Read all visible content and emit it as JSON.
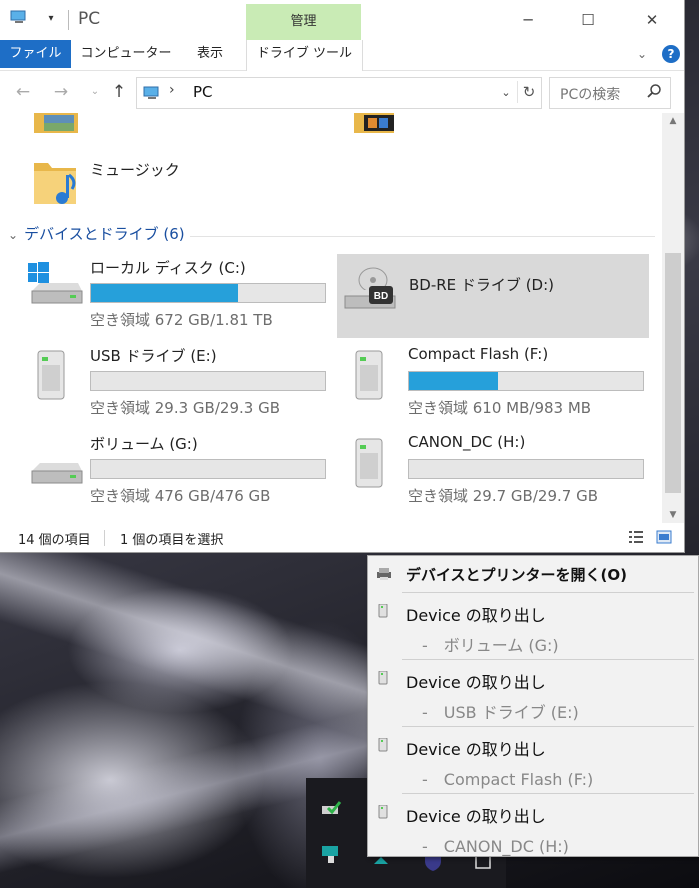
{
  "window": {
    "title": "PC",
    "qa_dropdown_glyph": "▾",
    "manage_tab": "管理",
    "controls": {
      "minimize": "─",
      "maximize": "☐",
      "close": "✕"
    }
  },
  "ribbon": {
    "tabs": [
      "ファイル",
      "コンピューター",
      "表示",
      "ドライブ ツール"
    ],
    "collapse_glyph": "⌄",
    "help_glyph": "?"
  },
  "nav": {
    "back": "←",
    "forward": "→",
    "recent": "⌄",
    "up": "↑",
    "breadcrumb_sep": "›",
    "location": "PC",
    "dropdown": "⌄",
    "refresh": "↻"
  },
  "search": {
    "placeholder": "PCの検索"
  },
  "content": {
    "music_label": "ミュージック",
    "group_header": "デバイスとドライブ (6)",
    "group_chevron": "⌄",
    "drives": [
      {
        "name": "ローカル ディスク (C:)",
        "free": "空き領域 672 GB/1.81 TB",
        "used_fraction": 0.63,
        "icon": "windows-drive-icon"
      },
      {
        "name": "BD-RE ドライブ (D:)",
        "free": "",
        "used_fraction": null,
        "icon": "bd-drive-icon"
      },
      {
        "name": "USB ドライブ (E:)",
        "free": "空き領域 29.3 GB/29.3 GB",
        "used_fraction": 0.0,
        "icon": "usb-drive-icon"
      },
      {
        "name": "Compact Flash (F:)",
        "free": "空き領域 610 MB/983 MB",
        "used_fraction": 0.38,
        "icon": "usb-drive-icon"
      },
      {
        "name": "ボリューム (G:)",
        "free": "空き領域 476 GB/476 GB",
        "used_fraction": 0.0,
        "icon": "hard-drive-icon"
      },
      {
        "name": "CANON_DC (H:)",
        "free": "空き領域 29.7 GB/29.7 GB",
        "used_fraction": 0.0,
        "icon": "usb-drive-icon"
      }
    ]
  },
  "status": {
    "count": "14 個の項目",
    "selection": "1 個の項目を選択"
  },
  "context_menu": {
    "header": "デバイスとプリンターを開く(O)",
    "items": [
      {
        "action": "Device の取り出し",
        "device": "-　ボリューム (G:)"
      },
      {
        "action": "Device の取り出し",
        "device": "-　USB ドライブ (E:)"
      },
      {
        "action": "Device の取り出し",
        "device": "-　Compact Flash (F:)"
      },
      {
        "action": "Device の取り出し",
        "device": "-　CANON_DC (H:)"
      }
    ]
  },
  "colors": {
    "accent": "#1e6ec6",
    "manage_tab_bg": "#c9ebb5",
    "bar_fill": "#26a0da",
    "selected_bg": "#d9d9d9",
    "group_header": "#1a4fa0"
  }
}
